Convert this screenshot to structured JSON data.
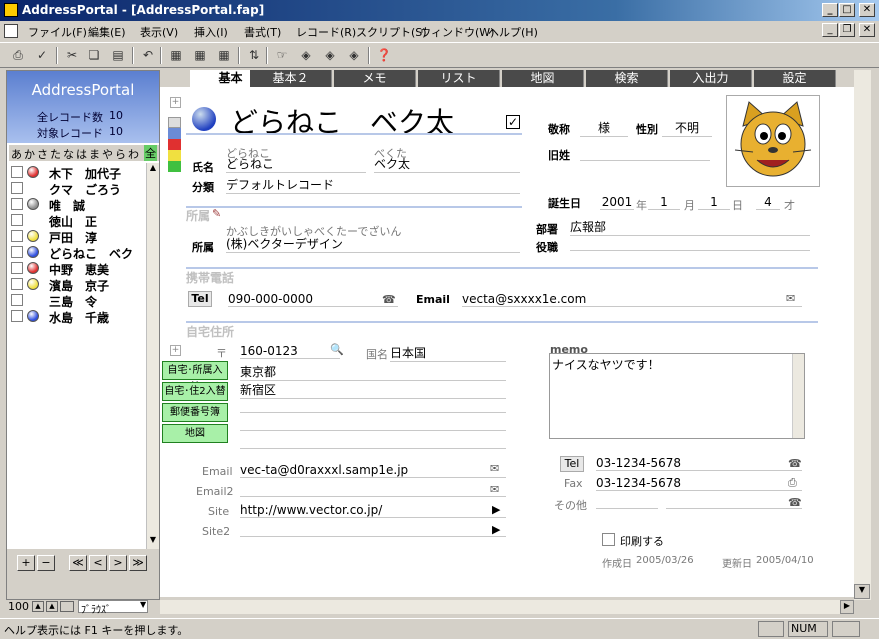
{
  "window": {
    "title": "AddressPortal - [AddressPortal.fap]"
  },
  "menu": [
    "ファイル(F)",
    "編集(E)",
    "表示(V)",
    "挿入(I)",
    "書式(T)",
    "レコード(R)",
    "スクリプト(S)",
    "ウィンドウ(W)",
    "ヘルプ(H)"
  ],
  "left": {
    "app_name": "AddressPortal",
    "total_label": "全レコード数",
    "total": "10",
    "target_label": "対象レコード",
    "target": "10",
    "kana": [
      "あ",
      "か",
      "さ",
      "た",
      "な",
      "は",
      "ま",
      "や",
      "ら",
      "わ",
      "全"
    ],
    "records": [
      {
        "name": "木下　加代子",
        "color": "#e03030"
      },
      {
        "name": "クマ　ごろう",
        "color": ""
      },
      {
        "name": "唯　誠",
        "color": "#909090"
      },
      {
        "name": "徳山　正",
        "color": ""
      },
      {
        "name": "戸田　淳",
        "color": "#f0e040"
      },
      {
        "name": "どらねこ　ベク",
        "color": "#3050e0"
      },
      {
        "name": "中野　恵美",
        "color": "#e03030"
      },
      {
        "name": "濱島　京子",
        "color": "#f0e040"
      },
      {
        "name": "三島　令",
        "color": ""
      },
      {
        "name": "水島　千歳",
        "color": "#3050e0"
      }
    ],
    "nav": [
      "+",
      "−",
      "≪",
      "<",
      ">",
      "≫"
    ]
  },
  "tabs": [
    "基本",
    "基本２",
    "メモ",
    "リスト",
    "地図",
    "検索",
    "入出力",
    "設定"
  ],
  "form": {
    "display_name": "どらねこ　ベク太",
    "honorific_label": "敬称",
    "honorific": "様",
    "gender_label": "性別",
    "gender": "不明",
    "kyusei_label": "旧姓",
    "name_label": "氏名",
    "last_kana": "どらねこ",
    "first_kana": "べくた",
    "last": "どらねこ",
    "first": "ベク太",
    "category_label": "分類",
    "category": "デフォルトレコード",
    "birthday_label": "誕生日",
    "birth_year": "2001",
    "year_unit": "年",
    "birth_month": "1",
    "month_unit": "月",
    "birth_day": "1",
    "day_unit": "日",
    "age": "4",
    "age_unit": "才",
    "company_section": "所属",
    "company_kana": "かぶしきがいしゃべくたーでざいん",
    "company_label": "所属",
    "company": "(株)ベクターデザイン",
    "dept_label": "部署",
    "dept": "広報部",
    "role_label": "役職",
    "mobile_section": "携帯電話",
    "tel_label": "Tel",
    "tel": "090-000-0000",
    "email_label": "Email",
    "email": "vecta@sxxxx1e.com",
    "home_section": "自宅住所",
    "zip_symbol": "〒",
    "zip": "160-0123",
    "country_label": "国名",
    "country": "日本国",
    "addr1": "東京都",
    "addr2": "新宿区",
    "buttons": [
      "自宅･所属入替",
      "自宅･住2入替",
      "郵便番号簿",
      "地図"
    ],
    "home_email_label": "Email",
    "home_email": "vec-ta@d0raxxxl.samp1e.jp",
    "email2_label": "Email2",
    "site_label": "Site",
    "site": "http://www.vector.co.jp/",
    "site2_label": "Site2",
    "memo_label": "memo",
    "memo": "ナイスなヤツです！",
    "home_tel_label": "Tel",
    "home_tel": "03-1234-5678",
    "fax_label": "Fax",
    "fax": "03-1234-5678",
    "other_label": "その他",
    "print_label": "印刷する",
    "created_label": "作成日",
    "created": "2005/03/26",
    "updated_label": "更新日",
    "updated": "2005/04/10"
  },
  "bottom": {
    "zoom": "100",
    "mode": "ﾌﾞﾗｳｽﾞ"
  },
  "status": {
    "help": "ヘルプ表示には F1 キーを押します。",
    "num": "NUM"
  }
}
